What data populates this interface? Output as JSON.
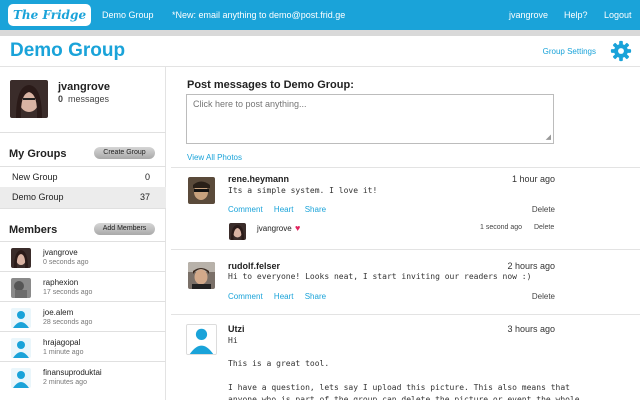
{
  "topbar": {
    "logo": "The Fridge",
    "group_link": "Demo Group",
    "notice": "*New: email anything to demo@post.frid.ge",
    "user": "jvangrove",
    "help": "Help?",
    "logout": "Logout"
  },
  "header": {
    "title": "Demo Group",
    "settings": "Group Settings",
    "gear_icon": "gear-icon"
  },
  "profile": {
    "name": "jvangrove",
    "messages_count": "0",
    "messages_label": "messages"
  },
  "groups": {
    "title": "My Groups",
    "create_button": "Create Group",
    "items": [
      {
        "name": "New Group",
        "count": "0"
      },
      {
        "name": "Demo Group",
        "count": "37"
      }
    ]
  },
  "members": {
    "title": "Members",
    "add_button": "Add Members",
    "items": [
      {
        "name": "jvangrove",
        "time": "0 seconds ago"
      },
      {
        "name": "raphexion",
        "time": "17 seconds ago"
      },
      {
        "name": "joe.alem",
        "time": "28 seconds ago"
      },
      {
        "name": "hrajagopal",
        "time": "1 minute ago"
      },
      {
        "name": "finansuproduktai",
        "time": "2 minutes ago"
      }
    ]
  },
  "compose": {
    "title": "Post messages to Demo Group:",
    "placeholder": "Click here to post anything...",
    "view_photos": "View All Photos"
  },
  "actions": {
    "comment": "Comment",
    "heart": "Heart",
    "share": "Share",
    "delete": "Delete"
  },
  "posts": [
    {
      "author": "rene.heymann",
      "time": "1 hour ago",
      "text": "Its a simple system. I love it!",
      "reply": {
        "author": "jvangrove",
        "time": "1 second ago",
        "delete": "Delete"
      }
    },
    {
      "author": "rudolf.felser",
      "time": "2 hours ago",
      "text": "Hi to everyone! Looks neat, I start inviting our readers now :)"
    },
    {
      "author": "Utzi",
      "time": "3 hours ago",
      "lines": [
        "Hi",
        "This is a great tool.",
        "I have a question, lets say I upload this picture. This also means that",
        "anyone who is part of the group can delete the picture or event the whole"
      ]
    }
  ],
  "colors": {
    "accent": "#1aa3d9",
    "heart": "#e0245e"
  }
}
